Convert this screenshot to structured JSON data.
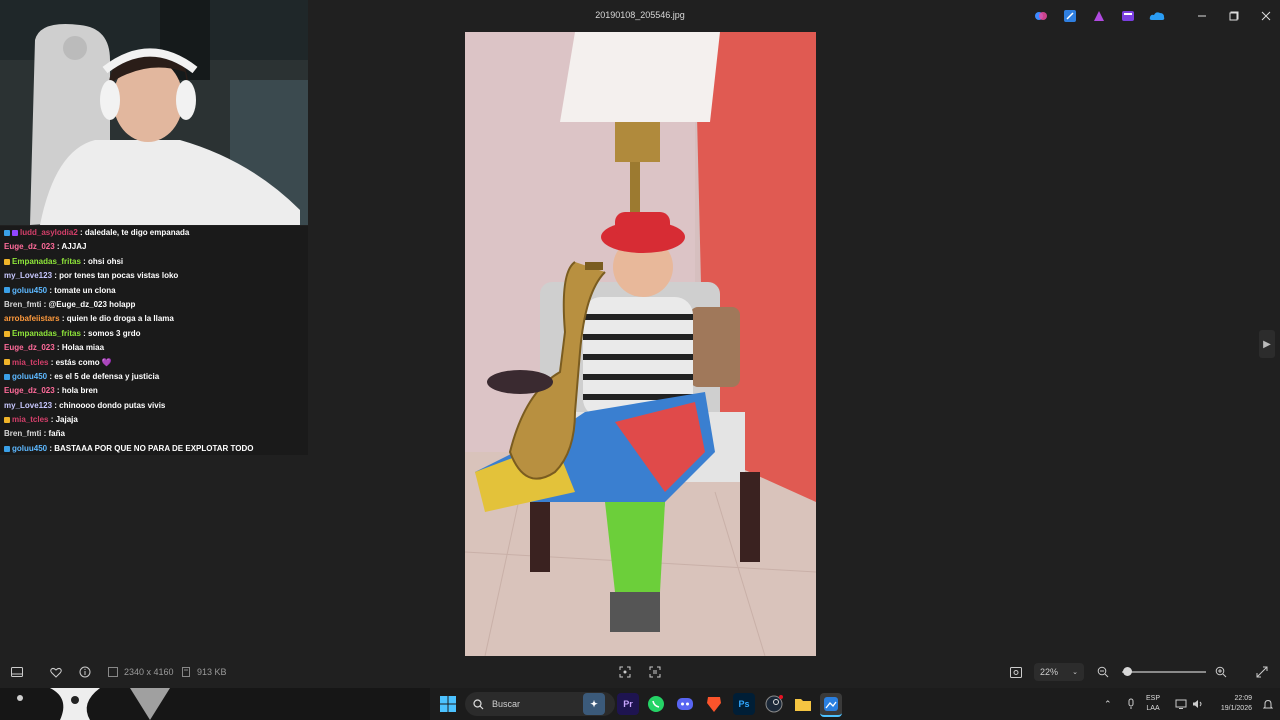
{
  "window": {
    "title": "20190108_205546.jpg"
  },
  "image_info": {
    "dimensions": "2340 x 4160",
    "file_size": "913 KB"
  },
  "zoom": {
    "level": "22%",
    "slider_value": 0.22
  },
  "chat": {
    "messages": [
      {
        "user": "ludd_asylodia2",
        "text": "daledale, te digo empanada",
        "color": "#d43f6a",
        "badges": [
          "#3aa0e8",
          "#9146ff"
        ]
      },
      {
        "user": "Euge_dz_023",
        "text": "AJJAJ",
        "color": "#ff6b9a",
        "badges": []
      },
      {
        "user": "Empanadas_fritas",
        "text": "ohsi ohsi",
        "color": "#8fe63a",
        "badges": [
          "#f0b429"
        ]
      },
      {
        "user": "my_Love123",
        "text": "por tenes tan pocas vistas loko",
        "color": "#c8c8ff",
        "badges": []
      },
      {
        "user": "goluu450",
        "text": "tomate un clona",
        "color": "#5db8ff",
        "badges": [
          "#3aa0e8"
        ]
      },
      {
        "user": "Bren_fmti",
        "text": "@Euge_dz_023 holapp",
        "color": "#d8d8d8",
        "badges": []
      },
      {
        "user": "arrobafeiistars",
        "text": "quien le dio droga a la llama",
        "color": "#ff9a3c",
        "badges": []
      },
      {
        "user": "Empanadas_fritas",
        "text": "somos 3 grdo",
        "color": "#8fe63a",
        "badges": [
          "#f0b429"
        ]
      },
      {
        "user": "Euge_dz_023",
        "text": "Holaa miaa",
        "color": "#ff6b9a",
        "badges": []
      },
      {
        "user": "mia_tcles",
        "text": "estás como 💜",
        "color": "#d43f6a",
        "badges": [
          "#f0b429"
        ]
      },
      {
        "user": "goluu450",
        "text": "es el 5 de defensa y justicia",
        "color": "#5db8ff",
        "badges": [
          "#3aa0e8"
        ]
      },
      {
        "user": "Euge_dz_023",
        "text": "hola bren",
        "color": "#ff6b9a",
        "badges": []
      },
      {
        "user": "my_Love123",
        "text": "chinoooo dondo putas vivis",
        "color": "#c8c8ff",
        "badges": []
      },
      {
        "user": "mia_tcles",
        "text": "Jajaja",
        "color": "#d43f6a",
        "badges": [
          "#f0b429"
        ]
      },
      {
        "user": "Bren_fmti",
        "text": "faña",
        "color": "#d8d8d8",
        "badges": []
      },
      {
        "user": "goluu450",
        "text": "BASTAAA POR QUE NO PARA DE EXPLOTAR TODO",
        "color": "#5db8ff",
        "badges": [
          "#3aa0e8"
        ]
      }
    ]
  },
  "taskbar": {
    "search_label": "Buscar",
    "lang_line1": "ESP",
    "lang_line2": "LAA",
    "time": "22:09",
    "date": "19/1/2026",
    "apps": [
      "Pr",
      "Ps"
    ]
  },
  "colors": {
    "background": "#202020",
    "accent": "#4cc2ff"
  }
}
